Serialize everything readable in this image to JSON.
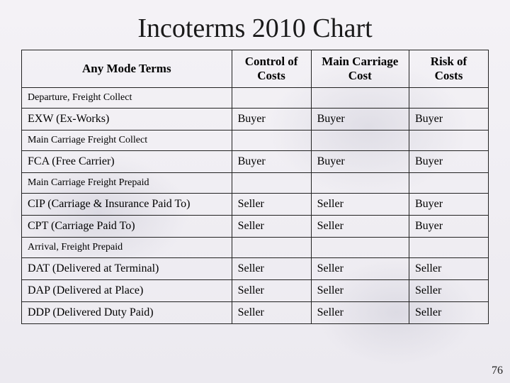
{
  "title": "Incoterms 2010 Chart",
  "page_number": "76",
  "columns": {
    "c0": "Any Mode Terms",
    "c1": "Control of Costs",
    "c2": "Main Carriage Cost",
    "c3": "Risk of Costs"
  },
  "groups": [
    {
      "label": "Departure, Freight Collect",
      "rows": [
        {
          "term": "EXW (Ex-Works)",
          "c1": "Buyer",
          "c2": "Buyer",
          "c3": "Buyer"
        }
      ]
    },
    {
      "label": "Main Carriage Freight Collect",
      "rows": [
        {
          "term": "FCA (Free Carrier)",
          "c1": "Buyer",
          "c2": "Buyer",
          "c3": "Buyer"
        }
      ]
    },
    {
      "label": "Main Carriage Freight Prepaid",
      "rows": [
        {
          "term": "CIP (Carriage & Insurance Paid To)",
          "c1": "Seller",
          "c2": "Seller",
          "c3": "Buyer"
        },
        {
          "term": "CPT (Carriage Paid To)",
          "c1": "Seller",
          "c2": "Seller",
          "c3": "Buyer"
        }
      ]
    },
    {
      "label": "Arrival, Freight Prepaid",
      "rows": [
        {
          "term": "DAT (Delivered at Terminal)",
          "c1": "Seller",
          "c2": "Seller",
          "c3": "Seller"
        },
        {
          "term": "DAP (Delivered at Place)",
          "c1": "Seller",
          "c2": "Seller",
          "c3": "Seller"
        },
        {
          "term": "DDP (Delivered Duty Paid)",
          "c1": "Seller",
          "c2": "Seller",
          "c3": "Seller"
        }
      ]
    }
  ],
  "chart_data": {
    "type": "table",
    "title": "Incoterms 2010 Chart",
    "columns": [
      "Any Mode Terms",
      "Control of Costs",
      "Main Carriage Cost",
      "Risk of Costs"
    ],
    "rows": [
      [
        "EXW (Ex-Works)",
        "Buyer",
        "Buyer",
        "Buyer"
      ],
      [
        "FCA (Free Carrier)",
        "Buyer",
        "Buyer",
        "Buyer"
      ],
      [
        "CIP (Carriage & Insurance Paid To)",
        "Seller",
        "Seller",
        "Buyer"
      ],
      [
        "CPT (Carriage Paid To)",
        "Seller",
        "Seller",
        "Buyer"
      ],
      [
        "DAT (Delivered at Terminal)",
        "Seller",
        "Seller",
        "Seller"
      ],
      [
        "DAP (Delivered at Place)",
        "Seller",
        "Seller",
        "Seller"
      ],
      [
        "DDP (Delivered Duty Paid)",
        "Seller",
        "Seller",
        "Seller"
      ]
    ]
  }
}
